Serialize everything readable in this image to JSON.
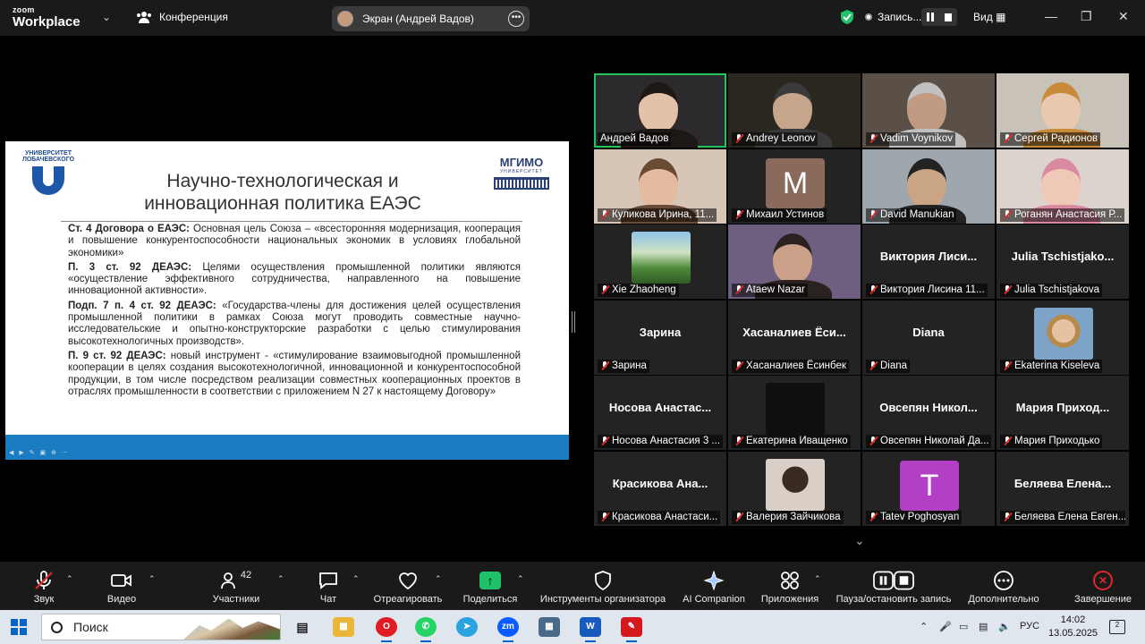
{
  "app": {
    "logo_line1": "zoom",
    "logo_line2": "Workplace",
    "meeting_label": "Конференция"
  },
  "screen_share": {
    "label": "Экран (Андрей Вадов)"
  },
  "recording": {
    "label": "Запись..."
  },
  "view_label": "Вид",
  "slide": {
    "university": "УНИВЕРСИТЕТ ЛОБАЧЕВСКОГО",
    "mgimo": "МГИМО",
    "mgimo_sub": "УНИВЕРСИТЕТ",
    "title": "Научно-технологическая и инновационная политика ЕАЭС",
    "p1_bold": "Ст. 4 Договора о ЕАЭС:",
    "p1_text": " Основная цель Союза – «всесторонняя модернизация, кооперация и повышение конкурентоспособности национальных экономик в условиях глобальной экономики»",
    "p2_bold": "П. 3 ст. 92 ДЕАЭС:",
    "p2_text": " Целями осуществления промышленной политики являются «осуществление эффективного сотрудничества, направленного на повышение инновационной активности».",
    "p3_bold": "Подп. 7 п. 4 ст. 92 ДЕАЭС:",
    "p3_text": " «Государства-члены для достижения целей осуществления промышленной политики в рамках Союза могут проводить совместные научно-исследовательские и опытно-конструкторские разработки с целью стимулирования высокотехнологичных производств».",
    "p4_bold": "П. 9 ст. 92 ДЕАЭС:",
    "p4_text": " новый инструмент - «стимулирование взаимовыгодной промышленной кооперации в целях создания высокотехнологичной, инновационной и конкурентоспособной продукции, в том числе посредством реализации совместных кооперационных проектов в отраслях промышленности в соответствии с приложением N 27 к настоящему Договору»"
  },
  "participants": [
    {
      "name": "Андрей Вадов",
      "muted": false,
      "kind": "video",
      "active": true
    },
    {
      "name": "Andrey Leonov",
      "muted": true,
      "kind": "video"
    },
    {
      "name": "Vadim Voynikov",
      "muted": true,
      "kind": "video"
    },
    {
      "name": "Сергей Радионов",
      "muted": true,
      "kind": "video"
    },
    {
      "name": "Куликова Ирина, 11...",
      "muted": true,
      "kind": "video"
    },
    {
      "name": "Михаил Устинов",
      "muted": true,
      "kind": "letter",
      "letter": "M",
      "color": "#8a6a5a"
    },
    {
      "name": "David Manukian",
      "muted": true,
      "kind": "video"
    },
    {
      "name": "Роганян Анастасия Р...",
      "muted": true,
      "kind": "video"
    },
    {
      "name": "Xie Zhaoheng",
      "muted": true,
      "kind": "pic"
    },
    {
      "name": "Ataew Nazar",
      "muted": true,
      "kind": "video"
    },
    {
      "name": "Виктория Лисина 11...",
      "muted": true,
      "kind": "text",
      "big": "Виктория Лиси..."
    },
    {
      "name": "Julia Tschistjakova",
      "muted": true,
      "kind": "text",
      "big": "Julia Tschistjako..."
    },
    {
      "name": "Зарина",
      "muted": true,
      "kind": "text",
      "big": "Зарина"
    },
    {
      "name": "Хасаналиев Ёсинбек",
      "muted": true,
      "kind": "text",
      "big": "Хасаналиев Ёси..."
    },
    {
      "name": "Diana",
      "muted": true,
      "kind": "text",
      "big": "Diana"
    },
    {
      "name": "Ekaterina Kiseleva",
      "muted": true,
      "kind": "pic"
    },
    {
      "name": "Носова Анастасия 3 ...",
      "muted": true,
      "kind": "text",
      "big": "Носова Анастас..."
    },
    {
      "name": "Екатерина Иващенко",
      "muted": true,
      "kind": "pic"
    },
    {
      "name": "Овсепян Николай Да...",
      "muted": true,
      "kind": "text",
      "big": "Овсепян Никол..."
    },
    {
      "name": "Мария Приходько",
      "muted": true,
      "kind": "text",
      "big": "Мария Приход..."
    },
    {
      "name": "Красикова Анастаси...",
      "muted": true,
      "kind": "text",
      "big": "Красикова Ана..."
    },
    {
      "name": "Валерия Зайчикова",
      "muted": true,
      "kind": "pic"
    },
    {
      "name": "Tatev Poghosyan",
      "muted": true,
      "kind": "letter",
      "letter": "T",
      "color": "#b23fc6"
    },
    {
      "name": "Беляева Елена Евген...",
      "muted": true,
      "kind": "text",
      "big": "Беляева Елена..."
    }
  ],
  "toolbar": {
    "audio": "Звук",
    "video": "Видео",
    "participants": "Участники",
    "participants_count": "42",
    "chat": "Чат",
    "react": "Отреагировать",
    "share": "Поделиться",
    "host_tools": "Инструменты организатора",
    "ai": "AI Companion",
    "apps": "Приложения",
    "pause_rec": "Пауза/остановить запись",
    "more": "Дополнительно",
    "end": "Завершение"
  },
  "taskbar": {
    "search_placeholder": "Поиск",
    "lang": "РУС",
    "time": "14:02",
    "date": "13.05.2025",
    "notif_count": "2"
  }
}
